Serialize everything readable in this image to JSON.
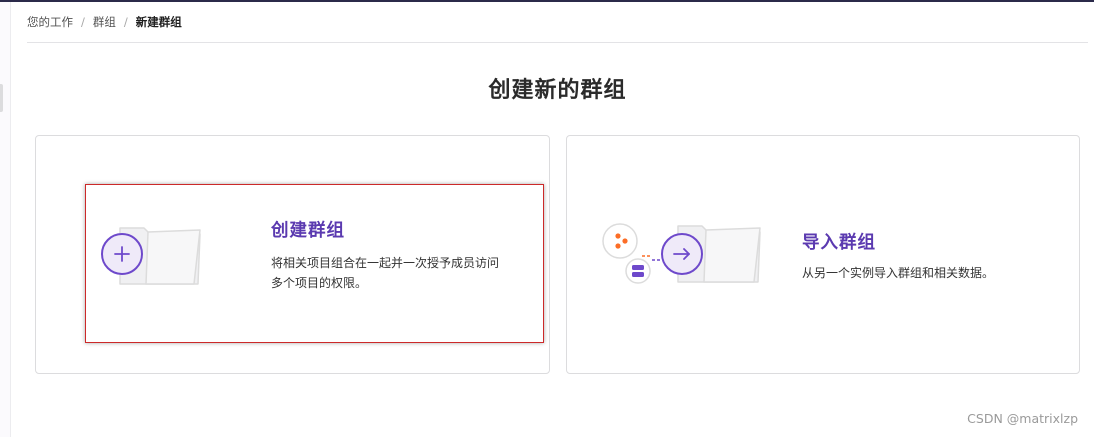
{
  "breadcrumb": {
    "items": [
      "您的工作",
      "群组"
    ],
    "current": "新建群组",
    "separator": "/"
  },
  "page": {
    "title": "创建新的群组"
  },
  "cards": {
    "create": {
      "title": "创建群组",
      "description_line1": "将相关项目组合在一起并一次授予成员访问",
      "description_line2": "多个项目的权限。",
      "icon": "plus-circle-icon"
    },
    "import": {
      "title": "导入群组",
      "description": "从另一个实例导入群组和相关数据。",
      "icon": "arrow-right-circle-icon"
    }
  },
  "watermark": {
    "text": "CSDN @matrixlzp"
  },
  "colors": {
    "accent": "#5b3ab0",
    "icon_purple": "#6e49cb",
    "highlight_border": "#cc2929",
    "orange": "#fc6d26",
    "topbar": "#2b2a4a"
  }
}
